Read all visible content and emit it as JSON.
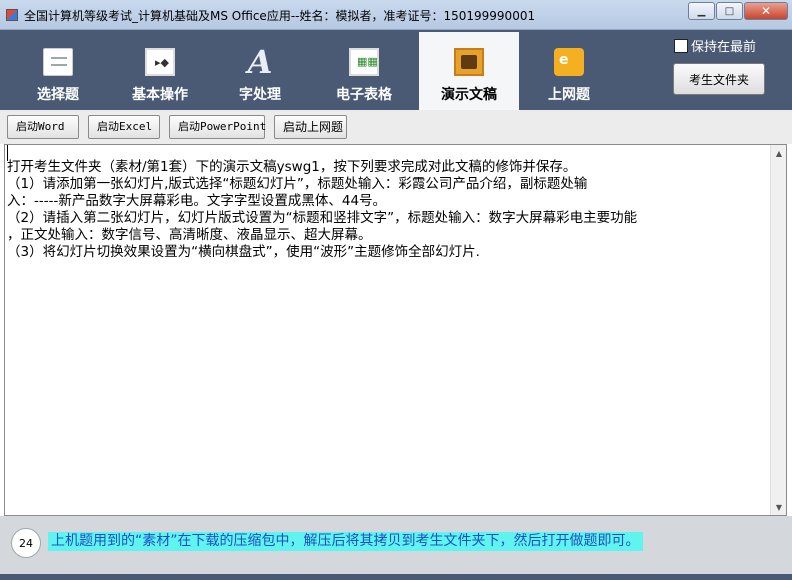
{
  "window": {
    "title": "全国计算机等级考试_计算机基础及MS Office应用--姓名：模拟者，准考证号：150199990001",
    "minimize": "▁",
    "maximize": "□",
    "close": "✕"
  },
  "toolbar": {
    "tabs": [
      {
        "label": "选择题",
        "icon": "document-icon"
      },
      {
        "label": "基本操作",
        "icon": "screen-icon"
      },
      {
        "label": "字处理",
        "icon": "letter-a-icon"
      },
      {
        "label": "电子表格",
        "icon": "spreadsheet-icon"
      },
      {
        "label": "演示文稿",
        "icon": "presentation-icon",
        "active": true
      },
      {
        "label": "上网题",
        "icon": "web-icon"
      }
    ],
    "keep_front_label": "保持在最前",
    "keep_front_checked": false,
    "folder_button": "考生文件夹"
  },
  "launch": {
    "word": "启动Word",
    "excel": "启动Excel",
    "powerpoint": "启动PowerPoint",
    "web": "启动上网题"
  },
  "question": {
    "intro": "打开考生文件夹（素材/第1套）下的演示文稿yswg1，按下列要求完成对此文稿的修饰并保存。",
    "item1_a": "（1）请添加第一张幻灯片,版式选择“标题幻灯片”，标题处输入：彩霞公司产品介绍，副标题处输",
    "item1_b": "入：-----新产品数字大屏幕彩电。文字字型设置成黑体、44号。",
    "item2_a": "（2）请插入第二张幻灯片，幻灯片版式设置为“标题和竖排文字”，标题处输入：数字大屏幕彩电主要功能",
    "item2_b": "，正文处输入：数字信号、高清晰度、液晶显示、超大屏幕。",
    "item3": "（3）将幻灯片切换效果设置为“横向棋盘式”，使用“波形”主题修饰全部幻灯片."
  },
  "footer": {
    "timer": "24",
    "notice": "上机题用到的“素材”在下载的压缩包中，解压后将其拷贝到考生文件夹下，然后打开做题即可。"
  },
  "colors": {
    "toolbar_bg": "#4a5a74",
    "notice_bg": "#5ff4ef",
    "notice_text": "#1f4fc8"
  }
}
